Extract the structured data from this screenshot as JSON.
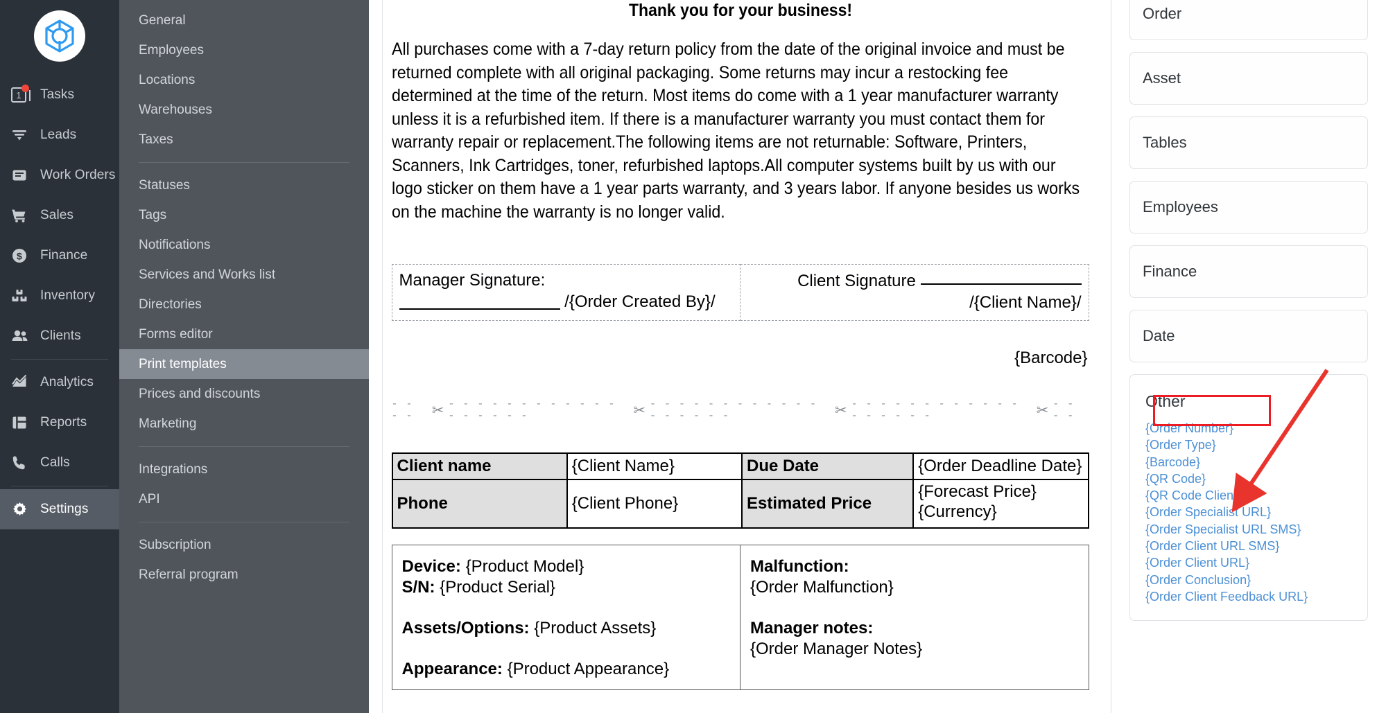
{
  "app": {
    "logo_icon": "cube-logo-icon"
  },
  "sidebar": {
    "items": [
      {
        "label": "Tasks",
        "icon": "tasks-icon",
        "badge": "1",
        "has_dot": true,
        "active": false
      },
      {
        "label": "Leads",
        "icon": "funnel-icon",
        "active": false
      },
      {
        "label": "Work Orders",
        "icon": "inbox-icon",
        "active": false
      },
      {
        "label": "Sales",
        "icon": "cart-icon",
        "active": false
      },
      {
        "label": "Finance",
        "icon": "dollar-circle-icon",
        "active": false
      },
      {
        "label": "Inventory",
        "icon": "boxes-icon",
        "active": false
      },
      {
        "label": "Clients",
        "icon": "people-icon",
        "active": false
      },
      {
        "label": "Analytics",
        "icon": "chart-area-icon",
        "active": false
      },
      {
        "label": "Reports",
        "icon": "grid-report-icon",
        "active": false
      },
      {
        "label": "Calls",
        "icon": "phone-icon",
        "active": false
      },
      {
        "label": "Settings",
        "icon": "gear-icon",
        "active": true
      }
    ]
  },
  "settings_menu": {
    "group1": [
      "General",
      "Employees",
      "Locations",
      "Warehouses",
      "Taxes"
    ],
    "group2": [
      "Statuses",
      "Tags",
      "Notifications",
      "Services and Works list",
      "Directories",
      "Forms editor",
      "Print templates",
      "Prices and discounts",
      "Marketing"
    ],
    "group3": [
      "Integrations",
      "API"
    ],
    "group4": [
      "Subscription",
      "Referral program"
    ],
    "active": "Print templates"
  },
  "document": {
    "title": "Thank you for your business!",
    "paragraph": "All purchases come with a 7-day return policy from the date of the original invoice and must be returned complete with all original packaging. Some returns may incur a restocking fee determined at the time of the return. Most items do come with a 1 year manufacturer warranty unless it is a refurbished item. If there is a manufacturer warranty you must contact them for warranty repair or replacement.The following items are not returnable: Software, Printers, Scanners, Ink Cartridges, toner, refurbished laptops.All computer systems built by us with our logo sticker on them have a 1 year parts warranty, and 3 years labor. If anyone besides us works on the machine the warranty is no longer valid.",
    "signature": {
      "manager_label": "Manager Signature:",
      "manager_placeholder": "/{Order Created By}/",
      "client_label": "Client Signature",
      "client_placeholder": "/{Client Name}/"
    },
    "barcode_placeholder": "{Barcode}",
    "cutline": {
      "dash_short": "- - - -",
      "dash_long": "- - - - - - - - - - - - - - - - - -",
      "scissors": "✂"
    },
    "client_table": {
      "row1": [
        "Client name",
        "{Client Name}",
        "Due Date",
        "{Order Deadline Date}"
      ],
      "row2": [
        "Phone",
        "{Client Phone}",
        "Estimated Price",
        "{Forecast Price} {Currency}"
      ]
    },
    "device_table": {
      "left": {
        "device_label": "Device:",
        "device_value": "{Product Model}",
        "sn_label": "S/N:",
        "sn_value": "{Product Serial}",
        "assets_label": "Assets/Options:",
        "assets_value": "{Product Assets}",
        "appearance_label": "Appearance:",
        "appearance_value": "{Product Appearance}"
      },
      "right": {
        "malfunction_label": "Malfunction:",
        "malfunction_value": "{Order Malfunction}",
        "notes_label": "Manager notes:",
        "notes_value": "{Order Manager Notes}"
      }
    }
  },
  "right_panel": {
    "cards": [
      "Order",
      "Asset",
      "Tables",
      "Employees",
      "Finance",
      "Date"
    ],
    "other": {
      "title": "Other",
      "links": [
        "{Order Number}",
        "{Order Type}",
        "{Barcode}",
        "{QR Code}",
        "{QR Code Client}",
        "{Order Specialist URL}",
        "{Order Specialist URL SMS}",
        "{Order Client URL SMS}",
        "{Order Client URL}",
        "{Order Conclusion}",
        "{Order Client Feedback URL}"
      ],
      "highlighted": [
        "{QR Code}",
        "{QR Code Client}"
      ]
    }
  },
  "annotation": {
    "highlight_color": "#ed1c24",
    "arrow_color": "#e8342c"
  },
  "colors": {
    "rail_bg": "#2b3138",
    "submenu_bg": "#50555c",
    "submenu_active": "#858b93",
    "link_blue": "#4b8fd4",
    "badge_red": "#f0453a",
    "logo_blue": "#2f9bf0"
  }
}
